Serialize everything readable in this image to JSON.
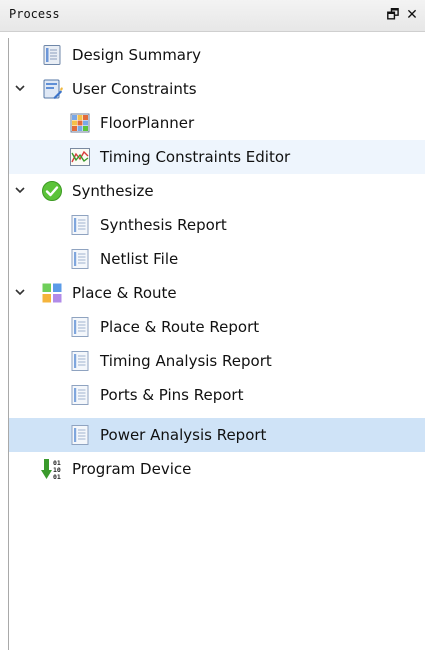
{
  "panel": {
    "title": "Process",
    "restore_glyph": "🗗",
    "close_glyph": "✕"
  },
  "tree": {
    "items": [
      {
        "label": "Design Summary",
        "level": 0,
        "icon": "document-icon"
      },
      {
        "label": "User Constraints",
        "level": 0,
        "icon": "constraints-icon",
        "expanded": true
      },
      {
        "label": "FloorPlanner",
        "level": 1,
        "icon": "floorplanner-icon"
      },
      {
        "label": "Timing Constraints Editor",
        "level": 1,
        "icon": "timing-graph-icon",
        "state": "hover"
      },
      {
        "label": "Synthesize",
        "level": 0,
        "icon": "check-circle-icon",
        "expanded": true
      },
      {
        "label": "Synthesis Report",
        "level": 1,
        "icon": "report-icon"
      },
      {
        "label": "Netlist File",
        "level": 1,
        "icon": "report-icon"
      },
      {
        "label": "Place & Route",
        "level": 0,
        "icon": "place-route-icon",
        "expanded": true
      },
      {
        "label": "Place & Route Report",
        "level": 1,
        "icon": "report-icon"
      },
      {
        "label": "Timing Analysis Report",
        "level": 1,
        "icon": "report-icon"
      },
      {
        "label": "Ports & Pins Report",
        "level": 1,
        "icon": "report-icon"
      },
      {
        "label": "Power Analysis Report",
        "level": 1,
        "icon": "report-icon",
        "state": "selected"
      },
      {
        "label": "Program Device",
        "level": 0,
        "icon": "program-device-icon"
      }
    ]
  },
  "colors": {
    "hover_background": "#eef5fd",
    "selected_background": "#cfe3f7",
    "check_green": "#5cc33a",
    "program_arrow_green": "#3a9a2c"
  }
}
